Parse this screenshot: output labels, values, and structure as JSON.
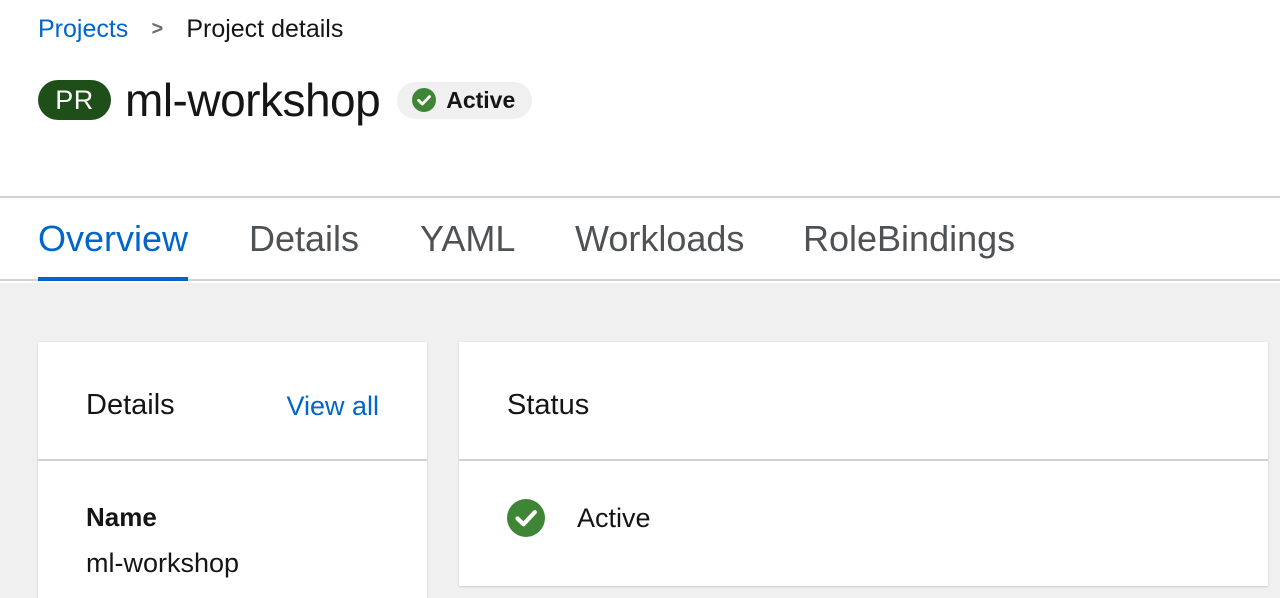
{
  "breadcrumb": {
    "parent": "Projects",
    "separator": ">",
    "current": "Project details"
  },
  "header": {
    "resource_badge": "PR",
    "resource_badge_color": "#1e4f18",
    "title": "ml-workshop",
    "status": "Active",
    "status_icon": "check-circle-icon",
    "status_color": "#3e8635"
  },
  "tabs": [
    {
      "label": "Overview",
      "active": true
    },
    {
      "label": "Details",
      "active": false
    },
    {
      "label": "YAML",
      "active": false
    },
    {
      "label": "Workloads",
      "active": false
    },
    {
      "label": "RoleBindings",
      "active": false
    }
  ],
  "details_card": {
    "title": "Details",
    "view_all": "View all",
    "fields": [
      {
        "term": "Name",
        "value": "ml-workshop"
      }
    ]
  },
  "status_card": {
    "title": "Status",
    "status": "Active",
    "status_icon": "check-circle-icon"
  },
  "colors": {
    "link": "#0066cc",
    "success": "#3e8635",
    "page_bg": "#f0f0f0"
  }
}
